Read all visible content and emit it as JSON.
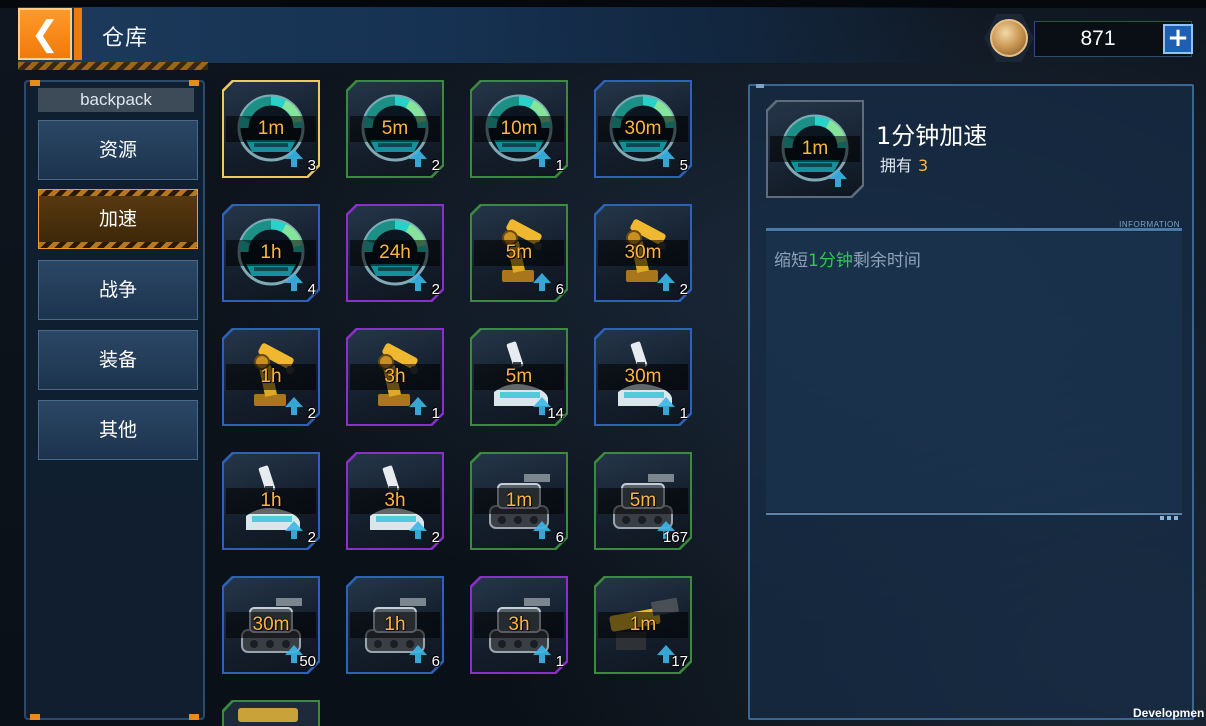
{
  "header": {
    "title": "仓库",
    "back_icon": "chevron-left-icon"
  },
  "currency": {
    "value": "871",
    "icon": "coin-icon",
    "add_icon": "plus-icon",
    "add_label": "+"
  },
  "sidebar": {
    "title": "backpack",
    "items": [
      {
        "label": "资源",
        "active": false
      },
      {
        "label": "加速",
        "active": true
      },
      {
        "label": "战争",
        "active": false
      },
      {
        "label": "装备",
        "active": false
      },
      {
        "label": "其他",
        "active": false
      }
    ]
  },
  "items": [
    {
      "label": "1m",
      "qty": "3",
      "kind": "speedometer",
      "quality": "gold",
      "selected": true
    },
    {
      "label": "5m",
      "qty": "2",
      "kind": "speedometer",
      "quality": "green"
    },
    {
      "label": "10m",
      "qty": "1",
      "kind": "speedometer",
      "quality": "green"
    },
    {
      "label": "30m",
      "qty": "5",
      "kind": "speedometer",
      "quality": "blue"
    },
    {
      "label": "1h",
      "qty": "4",
      "kind": "speedometer",
      "quality": "blue"
    },
    {
      "label": "24h",
      "qty": "2",
      "kind": "speedometer",
      "quality": "purple"
    },
    {
      "label": "5m",
      "qty": "6",
      "kind": "robot-arm",
      "quality": "green"
    },
    {
      "label": "30m",
      "qty": "2",
      "kind": "robot-arm",
      "quality": "blue"
    },
    {
      "label": "1h",
      "qty": "2",
      "kind": "robot-arm",
      "quality": "blue"
    },
    {
      "label": "3h",
      "qty": "1",
      "kind": "robot-arm",
      "quality": "purple"
    },
    {
      "label": "5m",
      "qty": "14",
      "kind": "microscope",
      "quality": "green"
    },
    {
      "label": "30m",
      "qty": "1",
      "kind": "microscope",
      "quality": "blue"
    },
    {
      "label": "1h",
      "qty": "2",
      "kind": "microscope",
      "quality": "blue"
    },
    {
      "label": "3h",
      "qty": "2",
      "kind": "microscope",
      "quality": "purple"
    },
    {
      "label": "1m",
      "qty": "6",
      "kind": "tank",
      "quality": "green"
    },
    {
      "label": "5m",
      "qty": "167",
      "kind": "tank",
      "quality": "green"
    },
    {
      "label": "30m",
      "qty": "50",
      "kind": "tank",
      "quality": "blue"
    },
    {
      "label": "1h",
      "qty": "6",
      "kind": "tank",
      "quality": "blue"
    },
    {
      "label": "3h",
      "qty": "1",
      "kind": "tank",
      "quality": "purple"
    },
    {
      "label": "1m",
      "qty": "17",
      "kind": "cannon",
      "quality": "green"
    }
  ],
  "detail": {
    "name": "1分钟加速",
    "own_label": "拥有",
    "own_count": "3",
    "icon_label": "1m",
    "info_tag": "INFORMATION",
    "desc_pre": "缩短",
    "desc_hl": "1分钟",
    "desc_post": "剩余时间"
  },
  "watermark": "Developmen",
  "colors": {
    "accent": "#f07a0a",
    "label": "#ffb63c",
    "highlight": "#2ec94d",
    "blue": "#2e62b8",
    "green": "#3b8a3e",
    "purple": "#8b2fc9"
  }
}
